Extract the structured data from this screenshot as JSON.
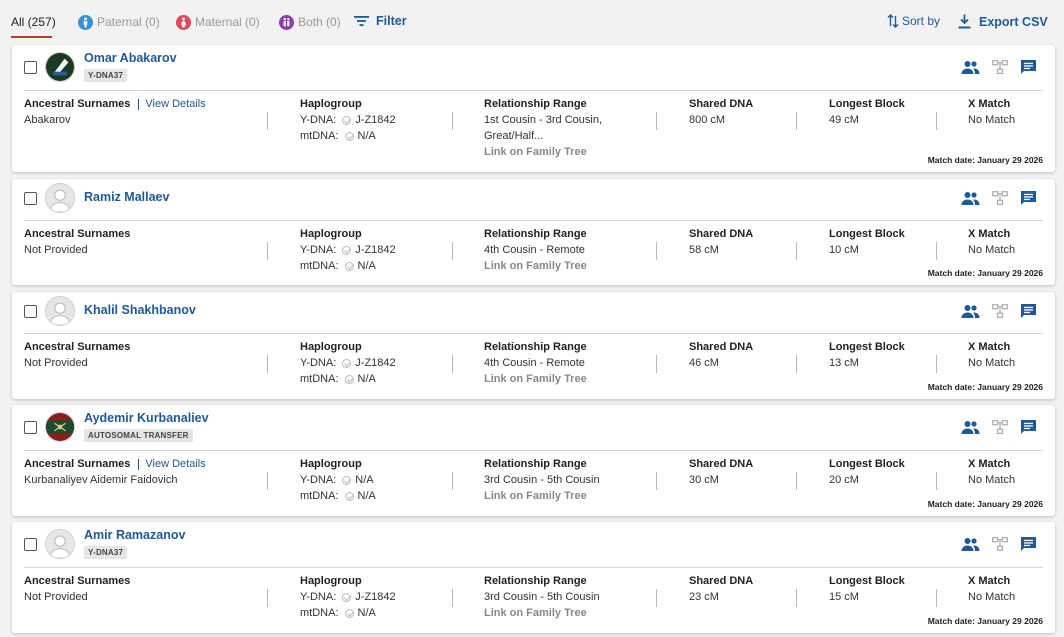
{
  "toolbar": {
    "tabs": {
      "all": "All (257)",
      "paternal": "Paternal (0)",
      "maternal": "Maternal (0)",
      "both": "Both (0)"
    },
    "filter_label": "Filter",
    "sort_label": "Sort by",
    "export_label": "Export CSV"
  },
  "labels": {
    "ancestral_surnames": "Ancestral Surnames",
    "view_details": "View Details",
    "haplogroup": "Haplogroup",
    "ydna": "Y-DNA:",
    "mtdna": "mtDNA:",
    "relationship_range": "Relationship Range",
    "link_family_tree": "Link on Family Tree",
    "shared_dna": "Shared DNA",
    "longest_block": "Longest Block",
    "x_match": "X Match"
  },
  "colors": {
    "accent_blue": "#1f5a96",
    "tab_underline": "#c0392b",
    "paternal": "#3a8fd6",
    "maternal": "#e0475e",
    "both": "#8e3fa8"
  },
  "matches": [
    {
      "name": "Omar Abakarov",
      "badge": "Y-DNA37",
      "avatar": "photo-dark-flag",
      "surnames": "Abakarov",
      "view_details": true,
      "ydna": "J-Z1842",
      "mtdna": "N/A",
      "relationship_line1": "1st Cousin - 3rd Cousin,",
      "relationship_line2": "Great/Half...",
      "shared_dna": "800 cM",
      "longest_block": "49 cM",
      "x_match": "No Match",
      "match_date": "Match date: January 29 2026"
    },
    {
      "name": "Ramiz Mallaev",
      "badge": "",
      "avatar": "default-person",
      "surnames": "Not Provided",
      "view_details": false,
      "ydna": "J-Z1842",
      "mtdna": "N/A",
      "relationship_line1": "4th Cousin - Remote",
      "relationship_line2": "",
      "shared_dna": "58 cM",
      "longest_block": "10 cM",
      "x_match": "No Match",
      "match_date": "Match date: January 29 2026"
    },
    {
      "name": "Khalil Shakhbanov",
      "badge": "",
      "avatar": "default-person",
      "surnames": "Not Provided",
      "view_details": false,
      "ydna": "J-Z1842",
      "mtdna": "N/A",
      "relationship_line1": "4th Cousin - Remote",
      "relationship_line2": "",
      "shared_dna": "46 cM",
      "longest_block": "13 cM",
      "x_match": "No Match",
      "match_date": "Match date: January 29 2026"
    },
    {
      "name": "Aydemir Kurbanaliev",
      "badge": "AUTOSOMAL TRANSFER",
      "avatar": "photo-emblem",
      "surnames": "Kurbanaliyev Aidemir Faidovich",
      "view_details": true,
      "ydna": "N/A",
      "mtdna": "N/A",
      "relationship_line1": "3rd Cousin - 5th Cousin",
      "relationship_line2": "",
      "shared_dna": "30 cM",
      "longest_block": "20 cM",
      "x_match": "No Match",
      "match_date": "Match date: January 29 2026"
    },
    {
      "name": "Amir Ramazanov",
      "badge": "Y-DNA37",
      "avatar": "default-person",
      "surnames": "Not Provided",
      "view_details": false,
      "ydna": "J-Z1842",
      "mtdna": "N/A",
      "relationship_line1": "3rd Cousin - 5th Cousin",
      "relationship_line2": "",
      "shared_dna": "23 cM",
      "longest_block": "15 cM",
      "x_match": "No Match",
      "match_date": "Match date: January 29 2026"
    }
  ]
}
